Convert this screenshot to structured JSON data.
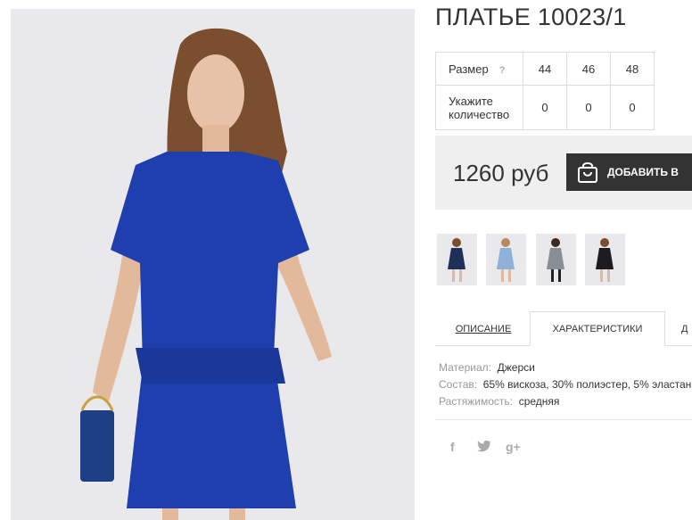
{
  "product": {
    "title": "ПЛАТЬЕ 10023/1",
    "price": "1260 руб",
    "add_button_label": "ДОБАВИТЬ В"
  },
  "size_table": {
    "size_label": "Размер",
    "help_label": "?",
    "sizes": [
      "44",
      "46",
      "48"
    ],
    "qty_label": "Укажите количество",
    "quantities": [
      "0",
      "0",
      "0"
    ]
  },
  "tabs": {
    "description": "ОПИСАНИЕ",
    "characteristics": "ХАРАКТЕРИСТИКИ",
    "more": "Д"
  },
  "characteristics": {
    "material_key": "Материал:",
    "material_val": "Джерси",
    "composition_key": "Состав:",
    "composition_val": "65% вискоза, 30% полиэстер, 5% эластан",
    "stretch_key": "Растяжимость:",
    "stretch_val": "средняя"
  },
  "thumbnails": [
    {
      "color": "navy",
      "hex": "#1f2f5a"
    },
    {
      "color": "light-blue",
      "hex": "#8fb0d8"
    },
    {
      "color": "grey",
      "hex": "#8a8d93"
    },
    {
      "color": "black",
      "hex": "#1d1d1f"
    }
  ],
  "social": {
    "facebook": "f",
    "twitter": "🐦",
    "googleplus": "g+"
  },
  "colors": {
    "dress": "#1f3fae",
    "button": "#333333",
    "price_bg": "#efefef"
  }
}
